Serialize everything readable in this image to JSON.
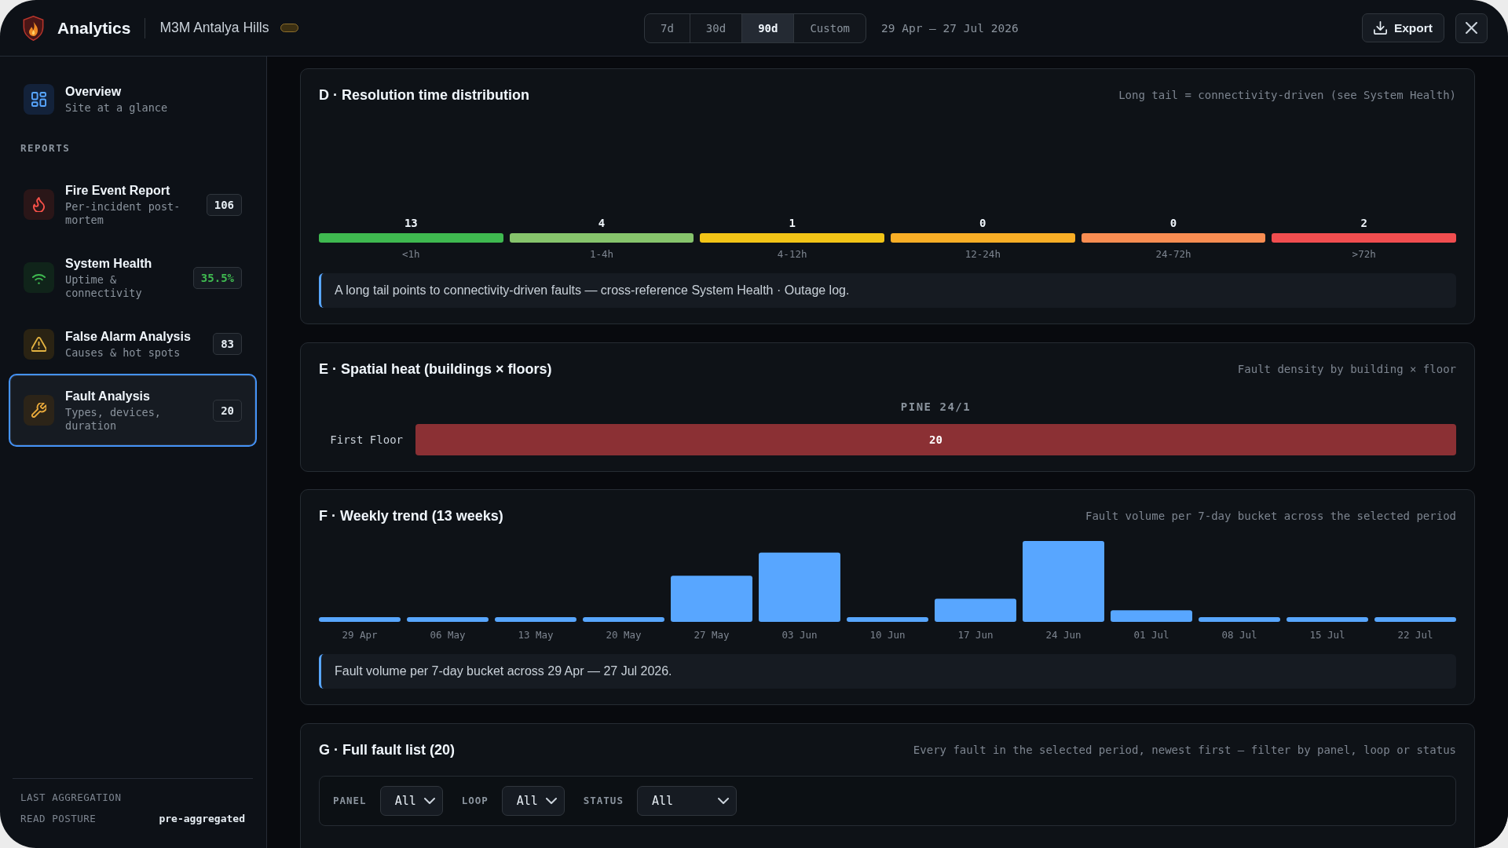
{
  "header": {
    "title": "Analytics",
    "site": "M3M Antalya Hills",
    "ranges": [
      {
        "label": "7d",
        "selected": false
      },
      {
        "label": "30d",
        "selected": false
      },
      {
        "label": "90d",
        "selected": true
      },
      {
        "label": "Custom",
        "selected": false
      }
    ],
    "date_range": "29 Apr — 27 Jul 2026",
    "export_label": "Export"
  },
  "sidebar": {
    "nav": [
      {
        "kind": "overview",
        "title": "Overview",
        "subtitle": "Site at a glance",
        "selected": false
      }
    ],
    "section_label": "REPORTS",
    "reports": [
      {
        "kind": "fire",
        "title": "Fire Event Report",
        "subtitle": "Per-incident post-mortem",
        "badge": "106",
        "badge_good": false,
        "selected": false
      },
      {
        "kind": "health",
        "title": "System Health",
        "subtitle": "Uptime & connectivity",
        "badge": "35.5%",
        "badge_good": true,
        "selected": false
      },
      {
        "kind": "false_alarm",
        "title": "False Alarm Analysis",
        "subtitle": "Causes & hot spots",
        "badge": "83",
        "badge_good": false,
        "selected": false
      },
      {
        "kind": "fault",
        "title": "Fault Analysis",
        "subtitle": "Types, devices, duration",
        "badge": "20",
        "badge_good": false,
        "selected": true
      }
    ],
    "footer": [
      {
        "label": "LAST AGGREGATION"
      },
      {
        "label": "READ POSTURE",
        "value": "pre-aggregated"
      }
    ]
  },
  "sections": [
    {
      "kind": "buckets",
      "title": "D · Resolution time distribution",
      "hint": "Long tail = connectivity-driven (see System Health)",
      "buckets": [
        {
          "label": "<1h",
          "count": "13",
          "color": "#3fb950"
        },
        {
          "label": "1-4h",
          "count": "4",
          "color": "#86c46c"
        },
        {
          "label": "4-12h",
          "count": "1",
          "color": "#f2c417"
        },
        {
          "label": "12-24h",
          "count": "0",
          "color": "#f8ae26"
        },
        {
          "label": "24-72h",
          "count": "0",
          "color": "#f98d52"
        },
        {
          "label": ">72h",
          "count": "2",
          "color": "#f04d4f"
        }
      ],
      "note": "A long tail points to connectivity-driven faults — cross-reference System Health · Outage log."
    },
    {
      "kind": "heat",
      "title": "E · Spatial heat (buildings × floors)",
      "hint": "Fault density by building × floor",
      "columns": [
        "PINE 24/1"
      ],
      "rows": [
        {
          "label": "First Floor",
          "cells": [
            "20"
          ]
        }
      ]
    },
    {
      "kind": "trend",
      "title": "F · Weekly trend (13 weeks)",
      "hint": "Fault volume per 7-day bucket across the selected period",
      "week_labels": [
        "29 Apr",
        "06 May",
        "13 May",
        "20 May",
        "27 May",
        "03 Jun",
        "10 Jun",
        "17 Jun",
        "24 Jun",
        "01 Jul",
        "08 Jul",
        "15 Jul",
        "22 Jul"
      ],
      "note": "Fault volume per 7-day bucket across 29 Apr — 27 Jul 2026."
    },
    {
      "kind": "list",
      "title": "G · Full fault list (20)",
      "hint": "Every fault in the selected period, newest first — filter by panel, loop or status",
      "filters": [
        {
          "label": "PANEL",
          "value": "All"
        },
        {
          "label": "LOOP",
          "value": "All"
        },
        {
          "label": "STATUS",
          "value": "All"
        }
      ]
    }
  ]
}
